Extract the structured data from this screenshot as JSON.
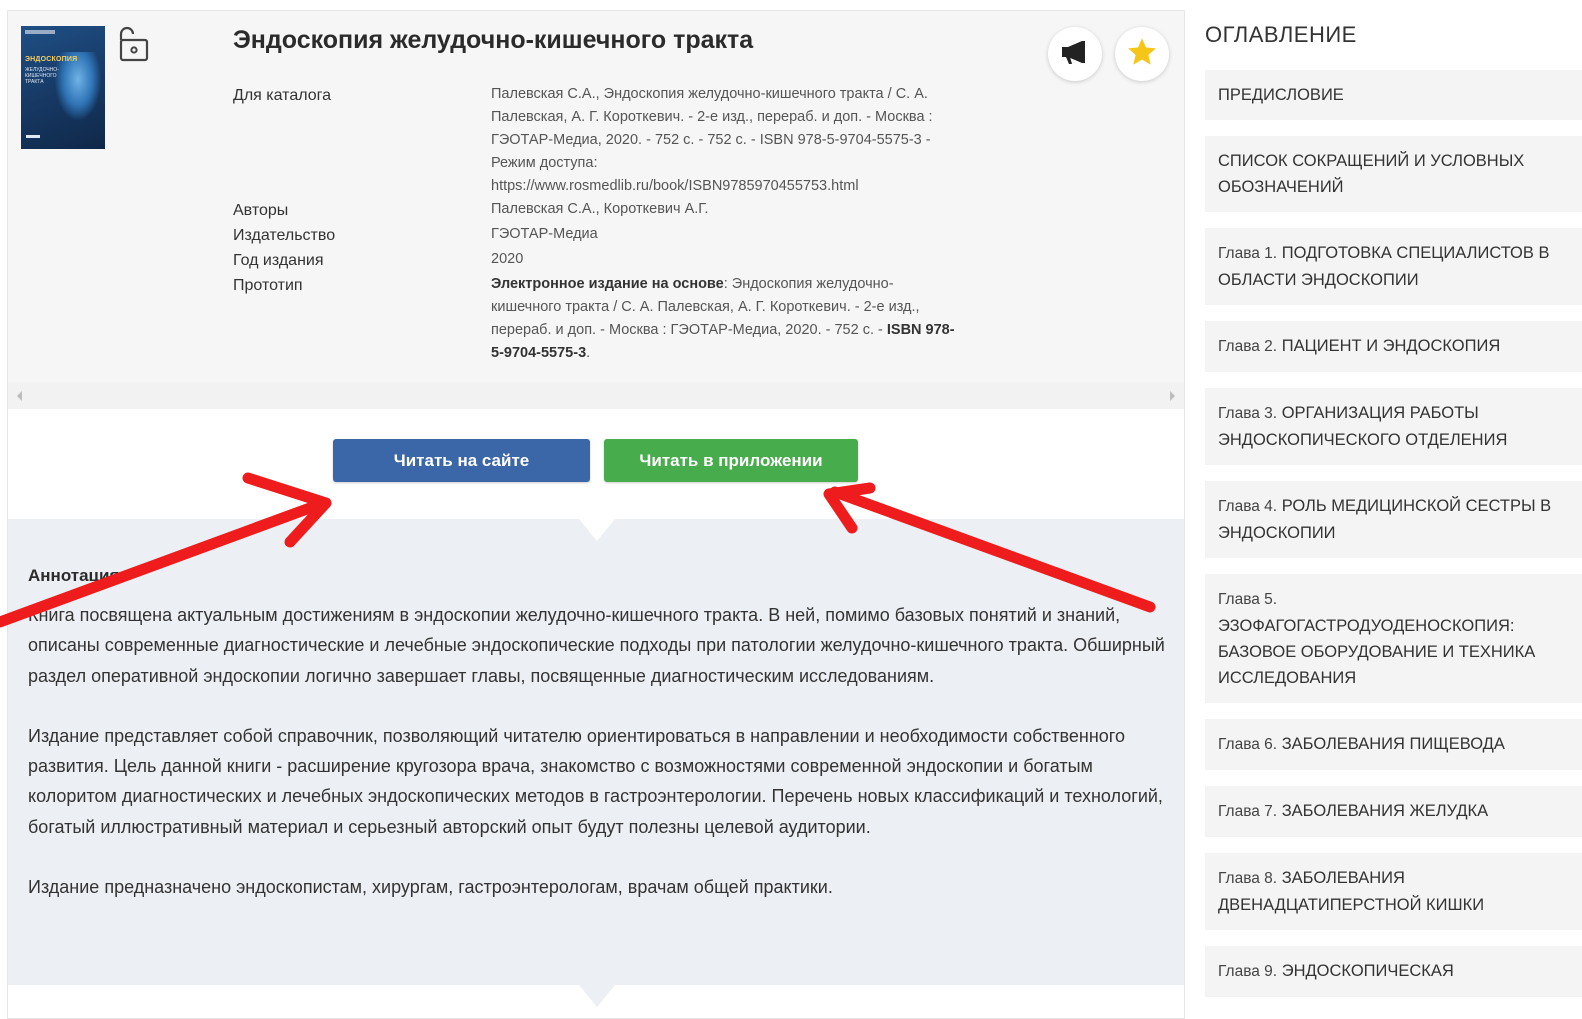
{
  "book": {
    "title": "Эндоскопия желудочно-кишечного тракта",
    "cover": {
      "title": "ЭНДОСКОПИЯ",
      "subtitle": "ЖЕЛУДОЧНО-КИШЕЧНОГО ТРАКТА"
    },
    "meta": [
      {
        "label": "Для каталога",
        "value": "Палевская С.А., Эндоскопия желудочно-кишечного тракта / С. А. Палевская, А. Г. Короткевич. - 2-е изд., перераб. и доп. - Москва : ГЭОТАР-Медиа, 2020. - 752 с. - 752 с. - ISBN 978-5-9704-5575-3 - Режим доступа: https://www.rosmedlib.ru/book/ISBN9785970455753.html"
      },
      {
        "label": "Авторы",
        "value": "Палевская С.А., Короткевич А.Г."
      },
      {
        "label": "Издательство",
        "value": "ГЭОТАР-Медиа"
      },
      {
        "label": "Год издания",
        "value": "2020"
      },
      {
        "label": "Прототип",
        "value_bold": "Электронное издание на основе",
        "value": ": Эндоскопия желудочно-кишечного тракта / С. А. Палевская, А. Г. Короткевич. - 2-е изд., перераб. и доп. - Москва : ГЭОТАР-Медиа, 2020. - 752 с. - ",
        "value_isbn": "ISBN 978-5-9704-5575-3",
        "value_end": "."
      }
    ]
  },
  "buttons": {
    "read_site": "Читать на сайте",
    "read_app": "Читать в приложении"
  },
  "annotation": {
    "title": "Аннотация",
    "paragraphs": [
      "Книга посвящена актуальным достижениям в эндоскопии желудочно-кишечного тракта. В ней, помимо базовых понятий и знаний, описаны современные диагностические и лечебные эндоскопические подходы при патологии желудочно-кишечного тракта. Обширный раздел оперативной эндоскопии логично завершает главы, посвященные диагностическим исследованиям.",
      "Издание представляет собой справочник, позволяющий читателю ориентироваться в направлении и необходимости собственного развития. Цель данной книги - расширение кругозора врача, знакомство с возможностями современной эндоскопии и богатым колоритом диагностических и лечебных эндоскопических методов в гастроэнтерологии. Перечень новых классификаций и технологий, богатый иллюстративный материал и серьезный авторский опыт будут полезны целевой аудитории.",
      "Издание предназначено эндоскопистам, хирургам, гастроэнтерологам, врачам общей практики."
    ]
  },
  "toc": {
    "title": "ОГЛАВЛЕНИЕ",
    "items": [
      {
        "chapter": "",
        "label": "ПРЕДИСЛОВИЕ"
      },
      {
        "chapter": "",
        "label": "СПИСОК СОКРАЩЕНИЙ И УСЛОВНЫХ ОБОЗНАЧЕНИЙ"
      },
      {
        "chapter": "Глава 1.",
        "label": "ПОДГОТОВКА СПЕЦИАЛИСТОВ В ОБЛАСТИ ЭНДОСКОПИИ"
      },
      {
        "chapter": "Глава 2.",
        "label": "ПАЦИЕНТ И ЭНДОСКОПИЯ"
      },
      {
        "chapter": "Глава 3.",
        "label": "ОРГАНИЗАЦИЯ РАБОТЫ ЭНДОСКОПИЧЕСКОГО ОТДЕЛЕНИЯ"
      },
      {
        "chapter": "Глава 4.",
        "label": "РОЛЬ МЕДИЦИНСКОЙ СЕСТРЫ В ЭНДОСКОПИИ"
      },
      {
        "chapter": "Глава 5.",
        "label": "ЭЗОФАГОГАСТРОДУОДЕНОСКОПИЯ: БАЗОВОЕ ОБОРУДОВАНИЕ И ТЕХНИКА ИССЛЕДОВАНИЯ"
      },
      {
        "chapter": "Глава 6.",
        "label": "ЗАБОЛЕВАНИЯ ПИЩЕВОДА"
      },
      {
        "chapter": "Глава 7.",
        "label": "ЗАБОЛЕВАНИЯ ЖЕЛУДКА"
      },
      {
        "chapter": "Глава 8.",
        "label": "ЗАБОЛЕВАНИЯ ДВЕНАДЦАТИПЕРСТНОЙ КИШКИ"
      },
      {
        "chapter": "Глава 9.",
        "label": "ЭНДОСКОПИЧЕСКАЯ"
      }
    ]
  },
  "colors": {
    "primary_button": "#3b66a8",
    "app_button": "#47ac4b",
    "arrow": "#ee1c1c",
    "star": "#f5c518"
  }
}
